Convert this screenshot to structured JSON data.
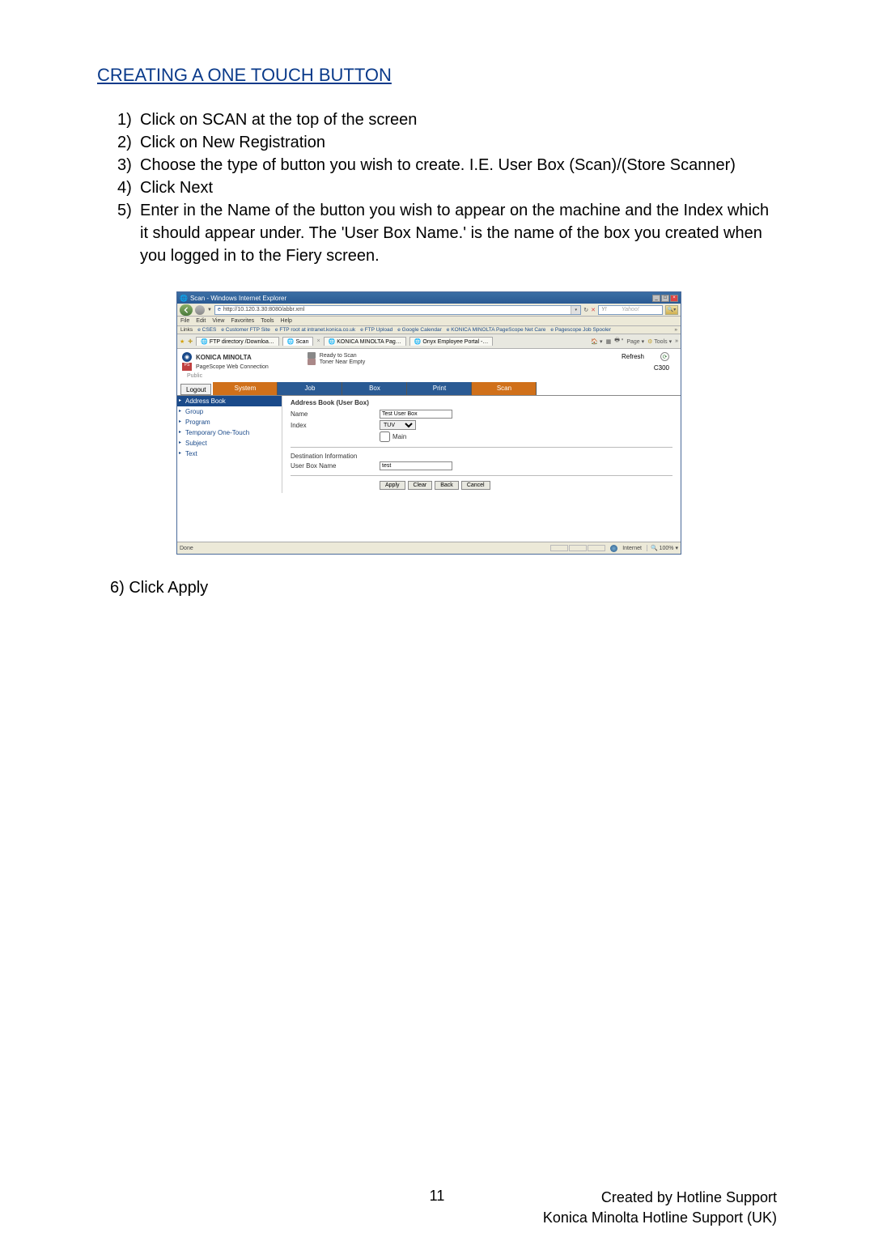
{
  "heading": "CREATING A ONE TOUCH BUTTON",
  "steps": [
    "Click on SCAN at the top of the screen",
    "Click on New Registration",
    "Choose the type of button you wish to create.  I.E. User Box (Scan)/(Store Scanner)",
    "Click Next",
    "Enter in the Name of the button you wish to appear on the machine and the Index which it should appear under.  The 'User Box Name.' is the name of the box you created when you logged in to the Fiery screen."
  ],
  "step6": "Click Apply",
  "footer": {
    "page": "11",
    "credit1": "Created by Hotline Support",
    "credit2": "Konica Minolta Hotline Support (UK)"
  },
  "screenshot": {
    "title": "Scan - Windows Internet Explorer",
    "url": "http://10.120.3.30:8080/abbr.xml",
    "search_placeholder": "Yahoo!",
    "menus": [
      "File",
      "Edit",
      "View",
      "Favorites",
      "Tools",
      "Help"
    ],
    "links_label": "Links",
    "links": [
      "CSES",
      "Customer FTP Site",
      "FTP root at intranet.konica.co.uk",
      "FTP Upload",
      "Google Calendar",
      "KONICA MINOLTA PageScope Net Care",
      "Pagescope Job Spooler"
    ],
    "tabs_left_label": "FTP directory /Downloa…",
    "tabs_active": "Scan",
    "tabs_others": [
      "KONICA MINOLTA Pag…",
      "Onyx Employee Portal -…"
    ],
    "tool_items": [
      "Page",
      "Tools"
    ],
    "brand": "KONICA MINOLTA",
    "brand_sub": "PageScope Web Connection",
    "statuses": [
      "Ready to Scan",
      "Toner Near Empty"
    ],
    "public": "Public",
    "refresh": "Refresh",
    "model": "C300",
    "logout": "Logout",
    "navtabs": [
      "System",
      "Job",
      "Box",
      "Print",
      "Scan"
    ],
    "side_items": [
      "Address Book",
      "Group",
      "Program",
      "Temporary One-Touch",
      "Subject",
      "Text"
    ],
    "side_active_index": 0,
    "form": {
      "title": "Address Book (User Box)",
      "name_label": "Name",
      "name_value": "Test User Box",
      "index_label": "Index",
      "index_value": "TUV",
      "main_label": "Main",
      "dest_title": "Destination Information",
      "userbox_label": "User Box Name",
      "userbox_value": "test",
      "buttons": [
        "Apply",
        "Clear",
        "Back",
        "Cancel"
      ]
    },
    "statusbar": {
      "left": "Done",
      "zone": "Internet",
      "zoom": "100%"
    }
  }
}
